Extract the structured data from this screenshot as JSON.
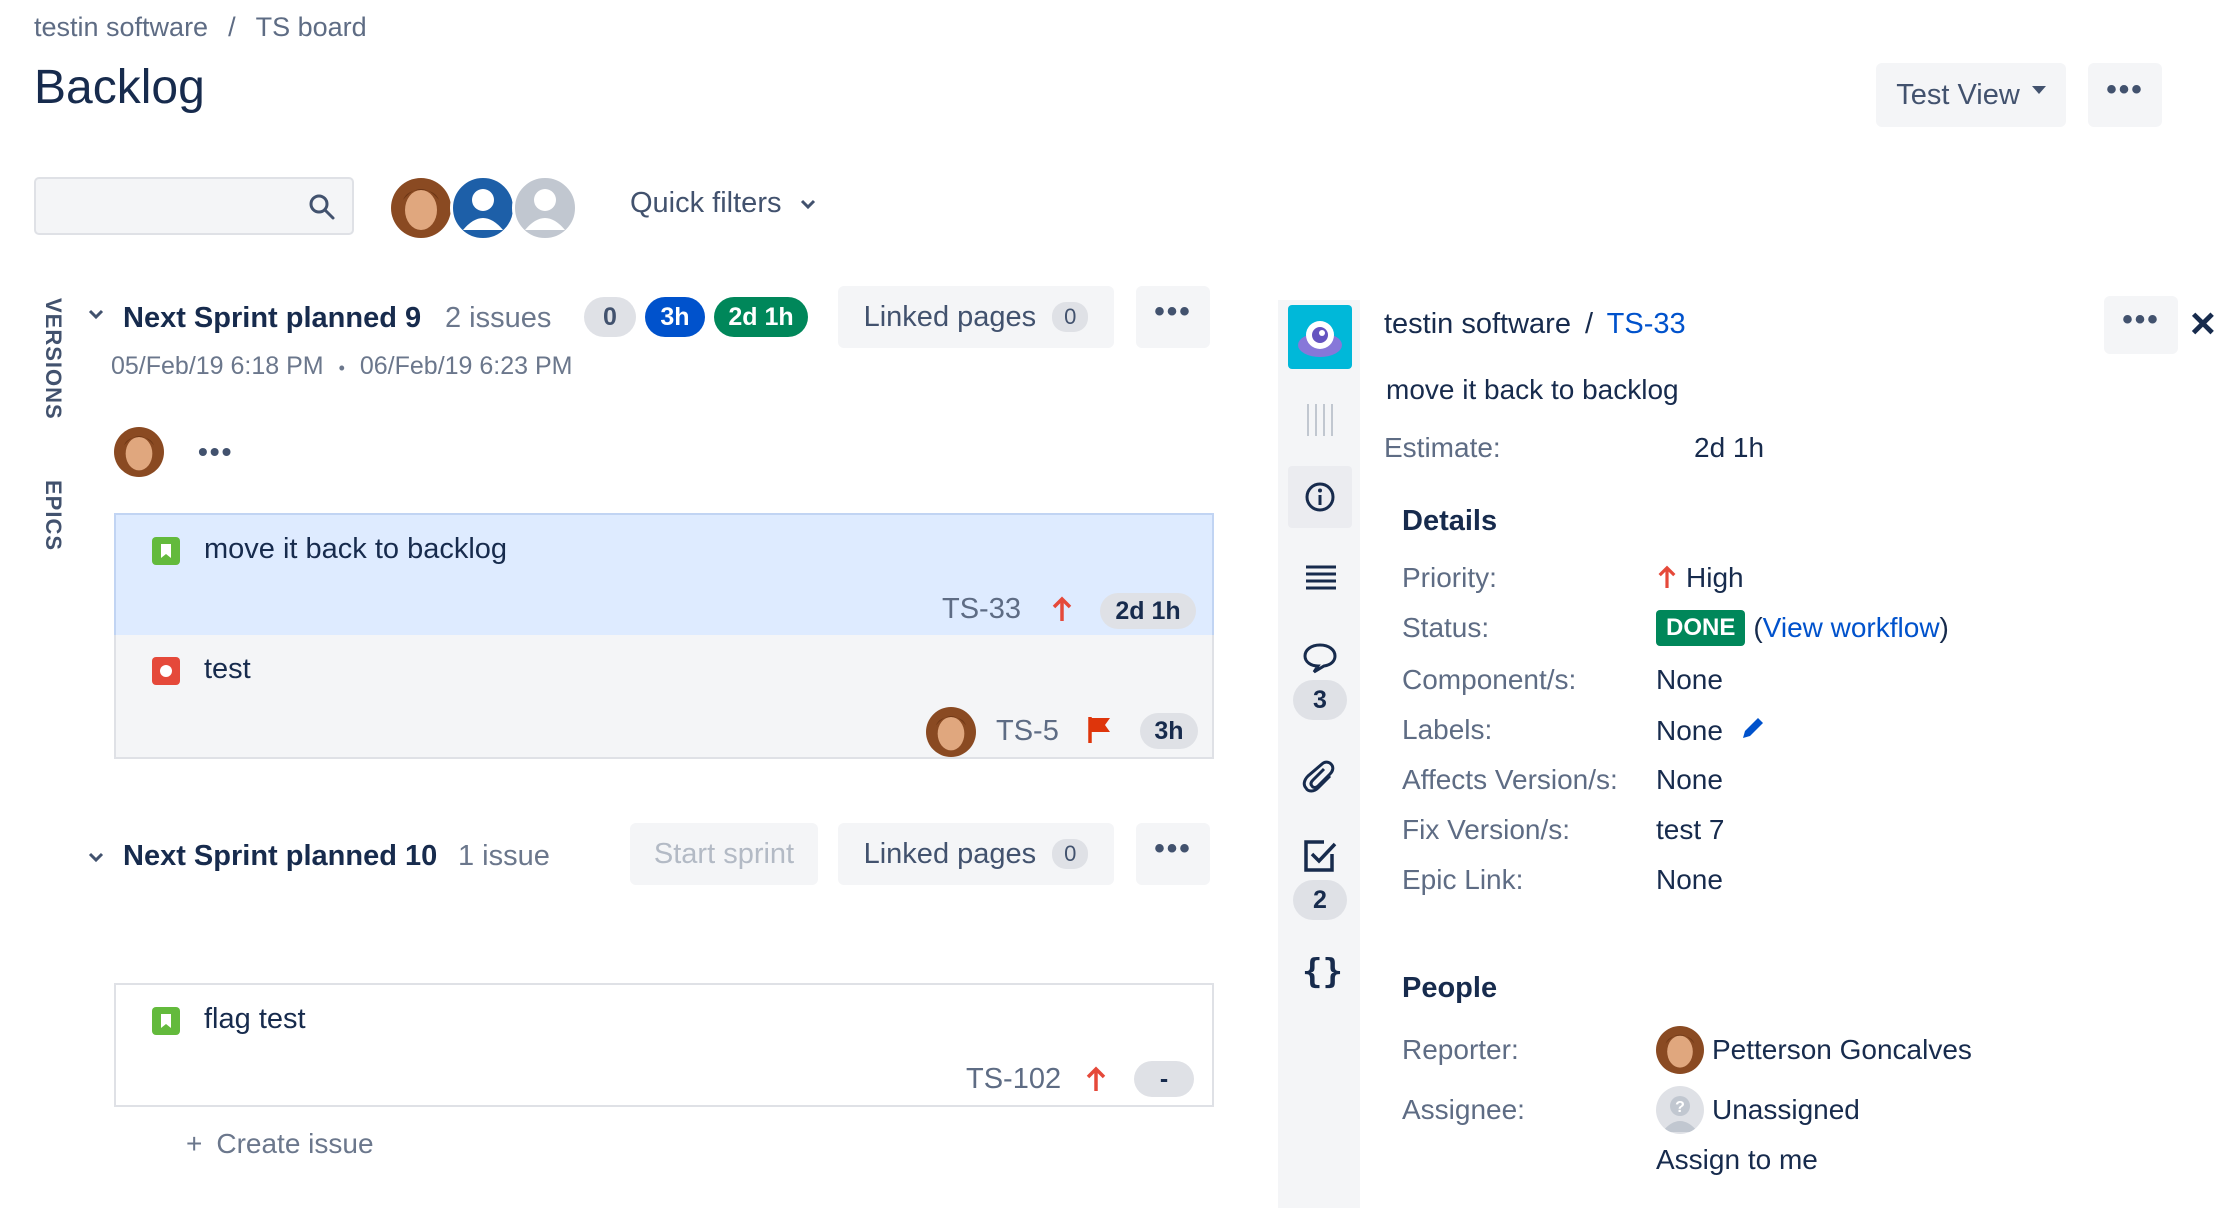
{
  "header": {
    "breadcrumb": [
      "testin software",
      "TS board"
    ],
    "breadcrumb_separator": "/",
    "title": "Backlog",
    "view_button": "Test View",
    "more_label": "•••"
  },
  "filters": {
    "search_placeholder": "",
    "quick_filters_label": "Quick filters"
  },
  "side_tabs": {
    "versions": "VERSIONS",
    "epics": "EPICS"
  },
  "sprint1": {
    "name": "Next Sprint planned 9",
    "issue_count": "2 issues",
    "lozenges": {
      "todo": "0",
      "in_progress": "3h",
      "done": "2d 1h"
    },
    "linked_pages_label": "Linked pages",
    "linked_pages_count": "0",
    "start_date": "05/Feb/19 6:18 PM",
    "dot": "•",
    "end_date": "06/Feb/19 6:23 PM",
    "more_label": "•••",
    "issues": [
      {
        "summary": "move it back to backlog",
        "key": "TS-33",
        "estimate": "2d 1h",
        "type": "story",
        "priority": "high"
      },
      {
        "summary": "test",
        "key": "TS-5",
        "estimate": "3h",
        "type": "bug",
        "flagged": true
      }
    ]
  },
  "sprint2": {
    "name": "Next Sprint planned 10",
    "issue_count": "1 issue",
    "start_sprint_label": "Start sprint",
    "linked_pages_label": "Linked pages",
    "linked_pages_count": "0",
    "more_label": "•••",
    "issues": [
      {
        "summary": "flag test",
        "key": "TS-102",
        "estimate": "-",
        "type": "story",
        "priority": "high"
      }
    ]
  },
  "create_issue": {
    "plus": "+",
    "label": "Create issue"
  },
  "detail": {
    "project": "testin software",
    "separator": "/",
    "issue_key": "TS-33",
    "summary": "move it back to backlog",
    "estimate_label": "Estimate:",
    "estimate_value": "2d 1h",
    "details_heading": "Details",
    "priority_label": "Priority:",
    "priority_value": "High",
    "status_label": "Status:",
    "status_value": "DONE",
    "view_workflow_open": "(",
    "view_workflow_label": "View workflow",
    "view_workflow_close": ")",
    "components_label": "Component/s:",
    "components_value": "None",
    "labels_label": "Labels:",
    "labels_value": "None",
    "affects_label": "Affects Version/s:",
    "affects_value": "None",
    "fix_label": "Fix Version/s:",
    "fix_value": "test 7",
    "epic_label": "Epic Link:",
    "epic_value": "None",
    "people_heading": "People",
    "reporter_label": "Reporter:",
    "reporter_value": "Petterson Goncalves",
    "assignee_label": "Assignee:",
    "assignee_value": "Unassigned",
    "assign_to_me": "Assign to me",
    "more_label": "•••",
    "close_label": "×",
    "rail": {
      "comments_count": "3",
      "subtasks_count": "2"
    }
  },
  "colors": {
    "accent_blue": "#0052cc",
    "done_green": "#00875a",
    "story_green": "#63ba3c",
    "bug_red": "#e5493a",
    "priority_red": "#e5493a",
    "selected_bg": "#deebff"
  },
  "icons": [
    "search-icon",
    "chevron-down-icon",
    "story-icon",
    "bug-icon",
    "priority-high-icon",
    "flag-icon",
    "info-icon",
    "description-icon",
    "comment-icon",
    "attachment-icon",
    "checkbox-icon",
    "code-icon",
    "pencil-icon",
    "close-icon"
  ]
}
